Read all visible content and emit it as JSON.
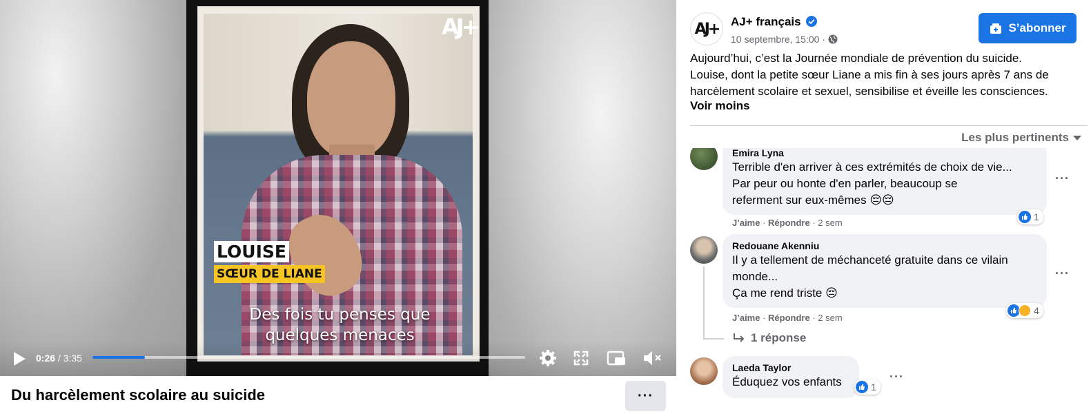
{
  "video": {
    "logo": "AJ+",
    "name_tag": "LOUISE",
    "role_tag": "SŒUR DE LIANE",
    "subtitle_line1": "Des fois tu penses que",
    "subtitle_line2": "quelques menaces",
    "current_time": "0:26",
    "duration": "3:35",
    "progress_fraction": 0.121,
    "title": "Du harcèlement scolaire au suicide"
  },
  "post": {
    "page_name": "AJ+ français",
    "date": "10 septembre, 15:00 ·",
    "subscribe_label": "S’abonner",
    "text_line1": "Aujourd’hui, c’est la Journée mondiale de prévention du suicide.",
    "text_line2": "Louise, dont la petite sœur Liane a mis fin à ses jours après 7 ans de",
    "text_line3": "harcèlement scolaire et sexuel, sensibilise et éveille les consciences.",
    "see_less": "Voir moins",
    "sort_label": "Les plus pertinents"
  },
  "comments": [
    {
      "author": "Emira Lyna",
      "line1": "Terrible d'en arriver à ces extrémités de choix de vie...",
      "line2": "Par peur ou honte d'en parler, beaucoup se",
      "line3": "referment sur eux-mêmes 😔😔",
      "like": "J’aime",
      "reply": "Répondre",
      "age": "2 sem",
      "reaction_count": "1"
    },
    {
      "author": "Redouane Akenniu",
      "line1": "Il y a tellement de méchanceté gratuite dans ce vilain",
      "line2": "monde...",
      "line3": "Ça me rend triste 😔",
      "like": "J’aime",
      "reply": "Répondre",
      "age": "2 sem",
      "reaction_count": "4",
      "replies": "1 réponse"
    },
    {
      "author": "Laeda Taylor",
      "line1": "Éduquez vos enfants",
      "reaction_count": "1"
    }
  ],
  "colors": {
    "accent": "#1b74e4",
    "bubble": "#f0f2f5",
    "muted_text": "#65676b",
    "tag_yellow": "#f6c425"
  }
}
